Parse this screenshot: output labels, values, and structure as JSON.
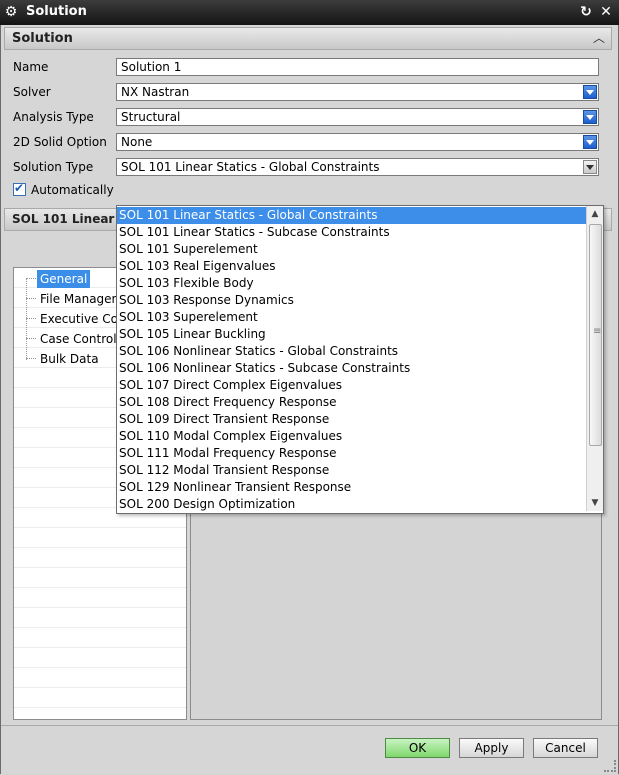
{
  "window": {
    "title": "Solution"
  },
  "section": {
    "title": "Solution"
  },
  "form": {
    "name": {
      "label": "Name",
      "value": "Solution 1"
    },
    "solver": {
      "label": "Solver",
      "value": "NX Nastran"
    },
    "analysis_type": {
      "label": "Analysis Type",
      "value": "Structural"
    },
    "solid_option": {
      "label": "2D Solid Option",
      "value": "None"
    },
    "solution_type": {
      "label": "Solution Type",
      "value": "SOL 101 Linear Statics - Global Constraints"
    },
    "auto_checkbox": {
      "label": "Automatically",
      "checked": true
    }
  },
  "subsection": {
    "title": "SOL 101 Linear S"
  },
  "tree": {
    "items": [
      "General",
      "File Managem",
      "Executive Co",
      "Case Control",
      "Bulk Data"
    ],
    "selected": "General"
  },
  "dropdown": {
    "options": [
      "SOL 101 Linear Statics - Global Constraints",
      "SOL 101 Linear Statics - Subcase Constraints",
      "SOL 101 Superelement",
      "SOL 103 Real Eigenvalues",
      "SOL 103 Flexible Body",
      "SOL 103 Response Dynamics",
      "SOL 103 Superelement",
      "SOL 105 Linear Buckling",
      "SOL 106 Nonlinear Statics - Global Constraints",
      "SOL 106 Nonlinear Statics - Subcase Constraints",
      "SOL 107 Direct Complex Eigenvalues",
      "SOL 108 Direct Frequency Response",
      "SOL 109 Direct Transient Response",
      "SOL 110 Modal Complex Eigenvalues",
      "SOL 111 Modal Frequency Response",
      "SOL 112 Modal Transient Response",
      "SOL 129 Nonlinear Transient Response",
      "SOL 200 Design Optimization"
    ],
    "selected_index": 0
  },
  "buttons": {
    "ok": "OK",
    "apply": "Apply",
    "cancel": "Cancel"
  },
  "colors": {
    "selection": "#3d8ee9",
    "ok_button": "#7fd86e",
    "titlebar": "#1e1e1e"
  }
}
